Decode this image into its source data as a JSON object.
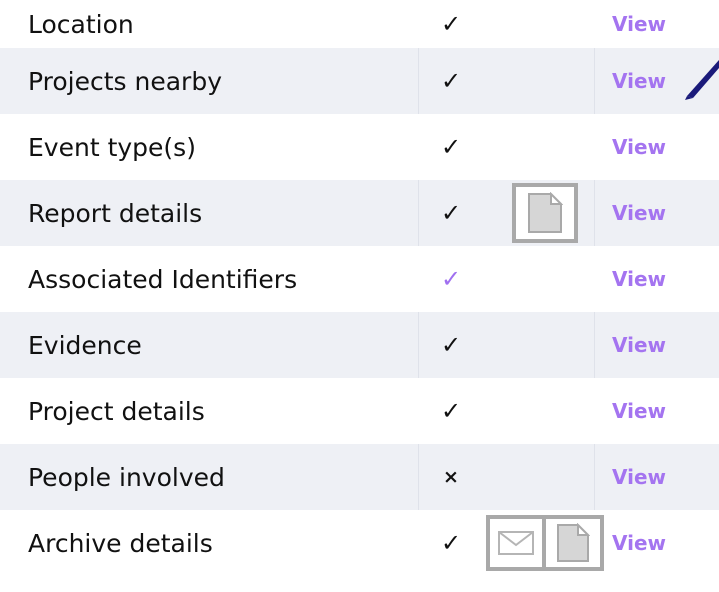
{
  "rows": [
    {
      "label": "Location",
      "status": "✓",
      "action": "View"
    },
    {
      "label": "Projects nearby",
      "status": "✓",
      "action": "View"
    },
    {
      "label": "Event type(s)",
      "status": "✓",
      "action": "View"
    },
    {
      "label": "Report details",
      "status": "✓",
      "action": "View"
    },
    {
      "label": "Associated Identifiers",
      "status": "✓",
      "action": "View"
    },
    {
      "label": "Evidence",
      "status": "✓",
      "action": "View"
    },
    {
      "label": "Project details",
      "status": "✓",
      "action": "View"
    },
    {
      "label": "People involved",
      "status": "×",
      "action": "View"
    },
    {
      "label": "Archive details",
      "status": "✓",
      "action": "View"
    }
  ],
  "colors": {
    "accent": "#a474f0",
    "check_accent": "#a070f0",
    "stripe": "#eef0f5",
    "icon_border": "#a9a9a9",
    "pen": "#1a1a7a"
  },
  "icons": {
    "report_details": [
      "document-icon"
    ],
    "archive_details": [
      "envelope-icon",
      "document-icon"
    ],
    "projects_nearby": [
      "pen-icon"
    ]
  }
}
